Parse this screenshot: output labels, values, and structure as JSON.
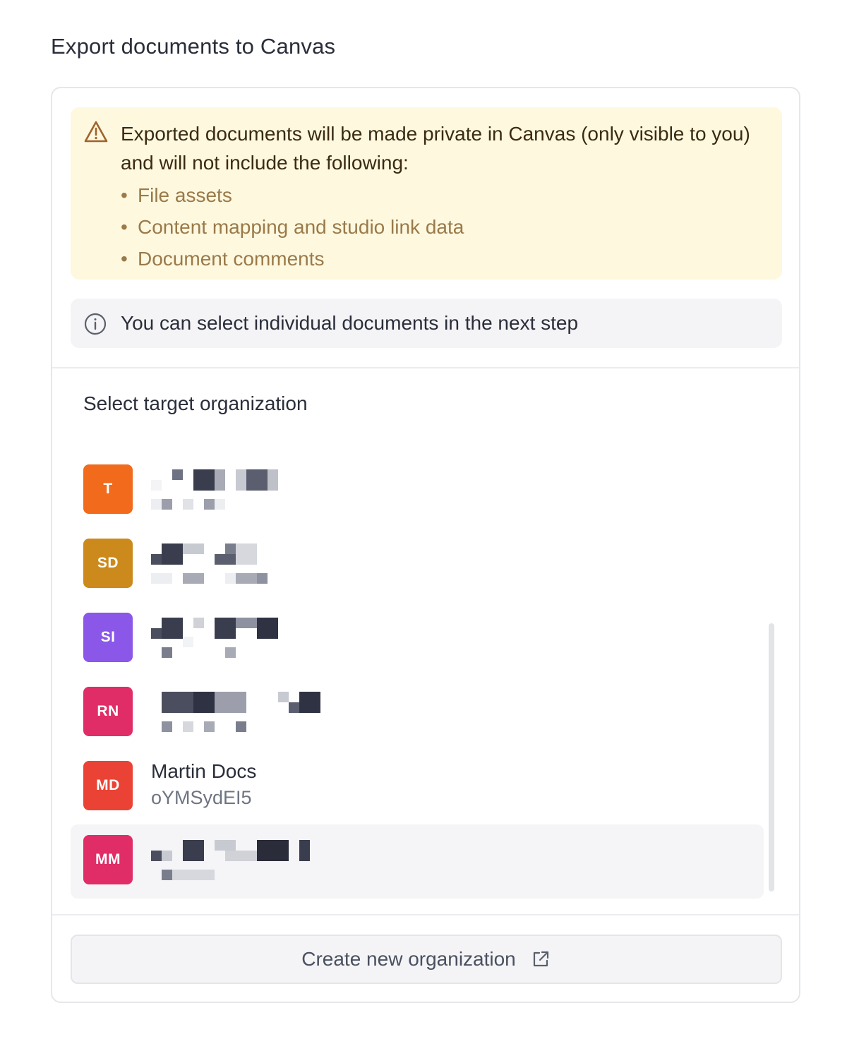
{
  "page": {
    "title": "Export documents to Canvas"
  },
  "warning": {
    "icon": "warning-triangle-icon",
    "message": "Exported documents will be made private in Canvas (only visible to you) and will not include the following:",
    "items": [
      "File assets",
      "Content mapping and studio link data",
      "Document comments"
    ]
  },
  "info": {
    "icon": "info-circle-icon",
    "message": "You can select individual documents in the next step"
  },
  "org_section": {
    "label": "Select target organization",
    "organizations": [
      {
        "initials": "T",
        "color": "#f26a1b",
        "name": "",
        "id": "",
        "redacted": true
      },
      {
        "initials": "SD",
        "color": "#cc8a1c",
        "name": "",
        "id": "",
        "redacted": true
      },
      {
        "initials": "SI",
        "color": "#8b57e8",
        "name": "",
        "id": "",
        "redacted": true
      },
      {
        "initials": "RN",
        "color": "#e02c67",
        "name": "",
        "id": "",
        "redacted": true
      },
      {
        "initials": "MD",
        "color": "#ea4335",
        "name": "Martin Docs",
        "id": "oYMSydEI5",
        "redacted": false
      },
      {
        "initials": "MM",
        "color": "#e02c67",
        "name": "",
        "id": "",
        "redacted": true,
        "hovered": true
      }
    ]
  },
  "create_button": {
    "label": "Create new organization",
    "icon": "external-link-icon"
  }
}
